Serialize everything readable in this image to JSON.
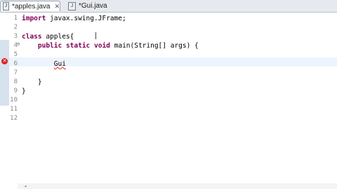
{
  "tabs": [
    {
      "label": "*apples.java",
      "close": "✕",
      "icon": "J"
    },
    {
      "label": "*Gui.java",
      "icon": "J"
    }
  ],
  "line_numbers": [
    "1",
    "2",
    "3",
    "4",
    "5",
    "6",
    "7",
    "8",
    "9",
    "10",
    "11",
    "12"
  ],
  "code": {
    "l1_kw": "import",
    "l1_rest": " javax.swing.JFrame;",
    "l3_kw": "class",
    "l3_rest": " apples{",
    "l4_indent": "    ",
    "l4_kw1": "public",
    "l4_sp1": " ",
    "l4_kw2": "static",
    "l4_sp2": " ",
    "l4_kw3": "void",
    "l4_rest": " main(String[] args) {",
    "l6_indent": "        ",
    "l6_text": "Gui",
    "l8_indent": "    ",
    "l8_text": "}",
    "l9_text": "}"
  },
  "markers": {
    "error": "✕",
    "fold": "⊖"
  },
  "scroll": {
    "arrow": "◂"
  }
}
